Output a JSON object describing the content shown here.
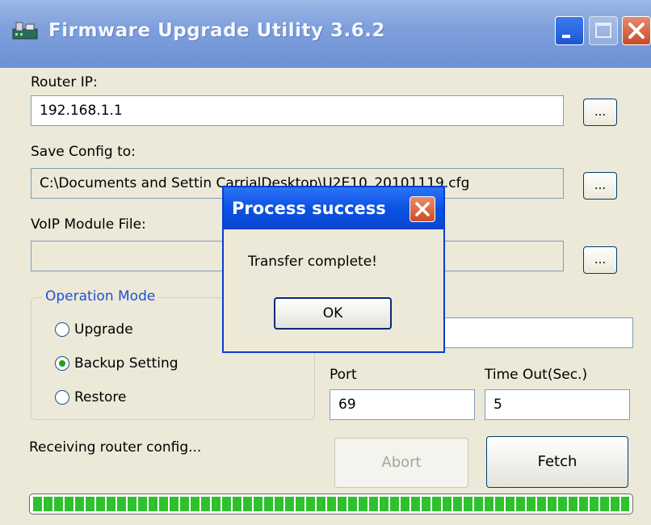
{
  "window": {
    "title": "Firmware Upgrade Utility 3.6.2",
    "controls": {
      "minimize": "minimize",
      "maximize": "maximize",
      "close": "close"
    }
  },
  "form": {
    "router_ip_label": "Router IP:",
    "router_ip_value": "192.168.1.1",
    "save_config_label": "Save Config to:",
    "save_config_value": "C:\\Documents and Settin          CarrialDesktop\\U2E10_20101119.cfg",
    "voip_label": "VoIP Module File:",
    "voip_value": "",
    "browse_label": "...",
    "port_label": "Port",
    "port_value": "69",
    "timeout_label": "Time Out(Sec.)",
    "timeout_value": "5"
  },
  "operation_mode": {
    "legend": "Operation Mode",
    "options": [
      {
        "label": "Upgrade",
        "selected": false
      },
      {
        "label": "Backup Setting",
        "selected": true
      },
      {
        "label": "Restore",
        "selected": false
      }
    ]
  },
  "status": {
    "text": "Receiving router config...",
    "progress_fraction": 1.0
  },
  "actions": {
    "abort_label": "Abort",
    "fetch_label": "Fetch"
  },
  "dialog": {
    "title": "Process success",
    "message": "Transfer complete!",
    "ok_label": "OK"
  }
}
